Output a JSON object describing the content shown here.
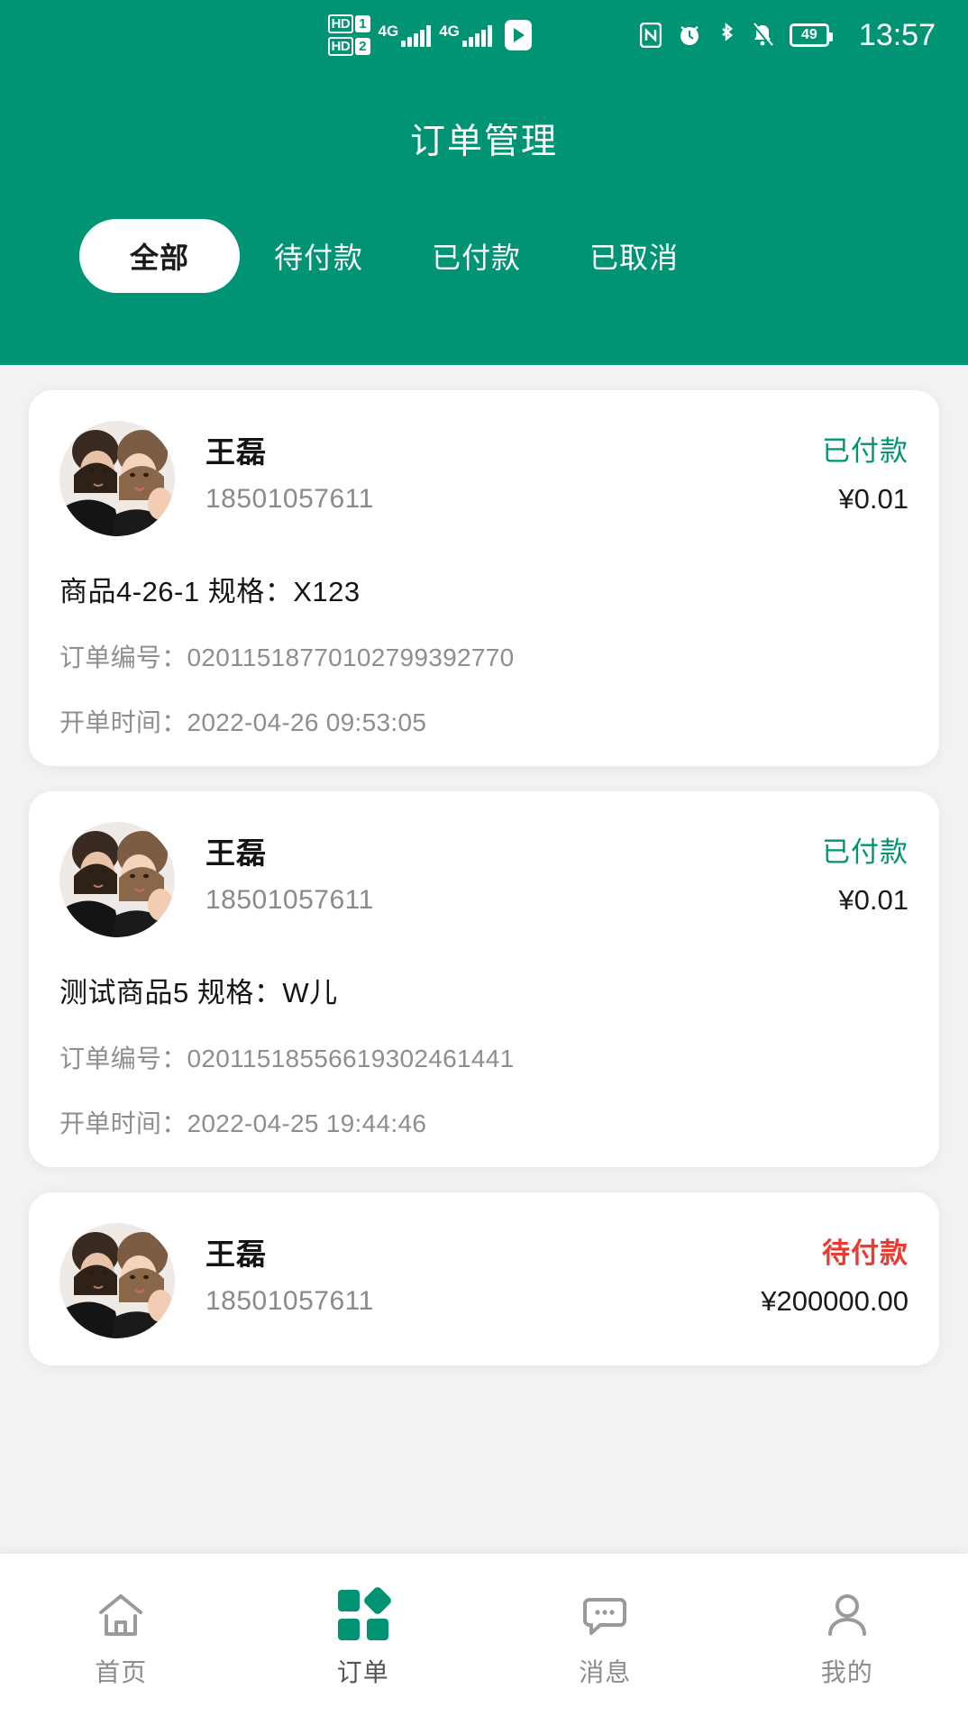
{
  "statusbar": {
    "sim1_hd": "HD",
    "sim1_num": "1",
    "sim2_hd": "HD",
    "sim2_num": "2",
    "net1": "4G",
    "net2": "4G",
    "icons": [
      "hd-sim-icon",
      "signal-bars-icon",
      "play-icon",
      "nfc-icon",
      "alarm-icon",
      "bluetooth-icon",
      "mute-bell-icon",
      "battery-icon"
    ],
    "battery_level": "49",
    "time": "13:57"
  },
  "header": {
    "title": "订单管理"
  },
  "tabs": [
    {
      "label": "全部",
      "active": true
    },
    {
      "label": "待付款",
      "active": false
    },
    {
      "label": "已付款",
      "active": false
    },
    {
      "label": "已取消",
      "active": false
    }
  ],
  "labels": {
    "order_no": "订单编号：",
    "created_at": "开单时间：",
    "spec": "规格：",
    "currency": "¥"
  },
  "orders": [
    {
      "name": "王磊",
      "phone": "18501057611",
      "status": "已付款",
      "status_type": "paid",
      "price": "¥0.01",
      "goods": "商品4-26-1",
      "spec": "规格：X123",
      "goods_line": "商品4-26-1  规格：X123",
      "order_no_line": "订单编号：02011518770102799392770",
      "order_no": "02011518770102799392770",
      "created_line": "开单时间：2022-04-26 09:53:05",
      "created_at": "2022-04-26 09:53:05"
    },
    {
      "name": "王磊",
      "phone": "18501057611",
      "status": "已付款",
      "status_type": "paid",
      "price": "¥0.01",
      "goods": "测试商品5",
      "spec": "规格：W儿",
      "goods_line": "测试商品5  规格：W儿",
      "order_no_line": "订单编号：02011518556619302461441",
      "order_no": "02011518556619302461441",
      "created_line": "开单时间：2022-04-25 19:44:46",
      "created_at": "2022-04-25 19:44:46"
    },
    {
      "name": "王磊",
      "phone": "18501057611",
      "status": "待付款",
      "status_type": "unpaid",
      "price": "¥200000.00"
    }
  ],
  "tabbar": [
    {
      "label": "首页",
      "icon": "home-icon",
      "active": false
    },
    {
      "label": "订单",
      "icon": "orders-grid-icon",
      "active": true
    },
    {
      "label": "消息",
      "icon": "message-icon",
      "active": false
    },
    {
      "label": "我的",
      "icon": "profile-icon",
      "active": false
    }
  ],
  "colors": {
    "brand": "#019474",
    "paid": "#019474",
    "unpaid": "#e83c32",
    "card": "#ffffff",
    "page_bg": "#f2f2f2"
  }
}
